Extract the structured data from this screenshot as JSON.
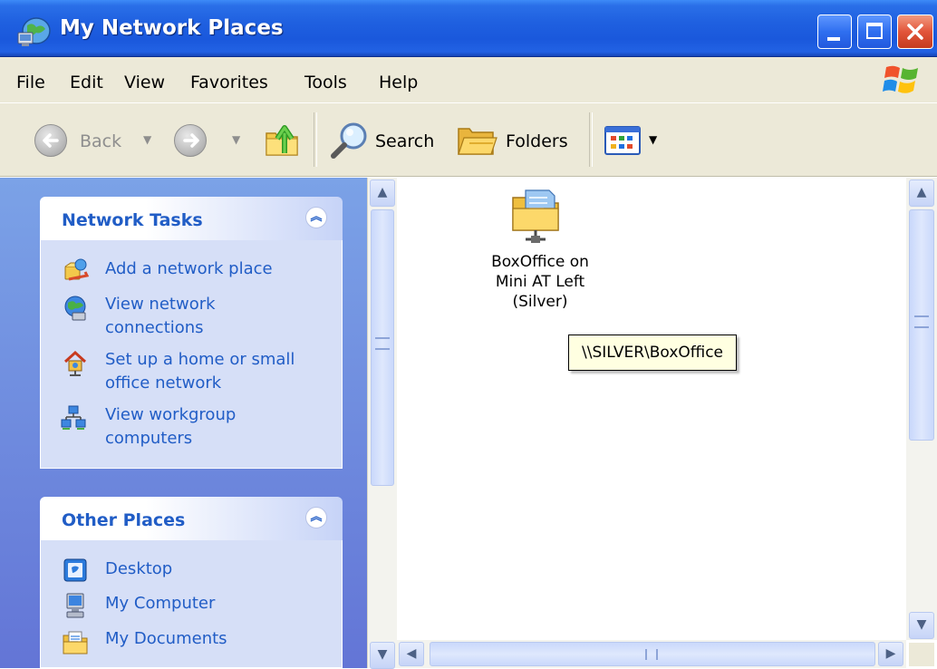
{
  "window": {
    "title": "My Network Places"
  },
  "menu": {
    "items": [
      "File",
      "Edit",
      "View",
      "Favorites",
      "Tools",
      "Help"
    ]
  },
  "toolbar": {
    "back_label": "Back",
    "search_label": "Search",
    "folders_label": "Folders",
    "icons": [
      "back-arrow-icon",
      "forward-arrow-icon",
      "up-folder-icon",
      "search-magnifier-icon",
      "folders-icon",
      "views-icon"
    ]
  },
  "task_pane": {
    "network_tasks": {
      "title": "Network Tasks",
      "items": [
        {
          "lines": [
            "Add a network place"
          ],
          "icon": "add-network-place-icon"
        },
        {
          "lines": [
            "View network",
            "connections"
          ],
          "icon": "network-connections-icon"
        },
        {
          "lines": [
            "Set up a home or small",
            "office network"
          ],
          "icon": "home-network-icon"
        },
        {
          "lines": [
            "View workgroup",
            "computers"
          ],
          "icon": "workgroup-icon"
        }
      ]
    },
    "other_places": {
      "title": "Other Places",
      "items": [
        {
          "label": "Desktop",
          "icon": "desktop-icon"
        },
        {
          "label": "My Computer",
          "icon": "my-computer-icon"
        },
        {
          "label": "My Documents",
          "icon": "my-documents-icon"
        }
      ]
    }
  },
  "content": {
    "items": [
      {
        "lines": [
          "BoxOffice on",
          "Mini AT Left",
          "(Silver)"
        ],
        "icon": "network-share-folder-icon",
        "tooltip": "\\\\SILVER\\BoxOffice"
      }
    ]
  },
  "colors": {
    "title_bar": "#1f60e0",
    "task_link": "#215dc6",
    "task_pane_bg": "#7ba2e7",
    "tooltip_bg": "#ffffe1"
  }
}
